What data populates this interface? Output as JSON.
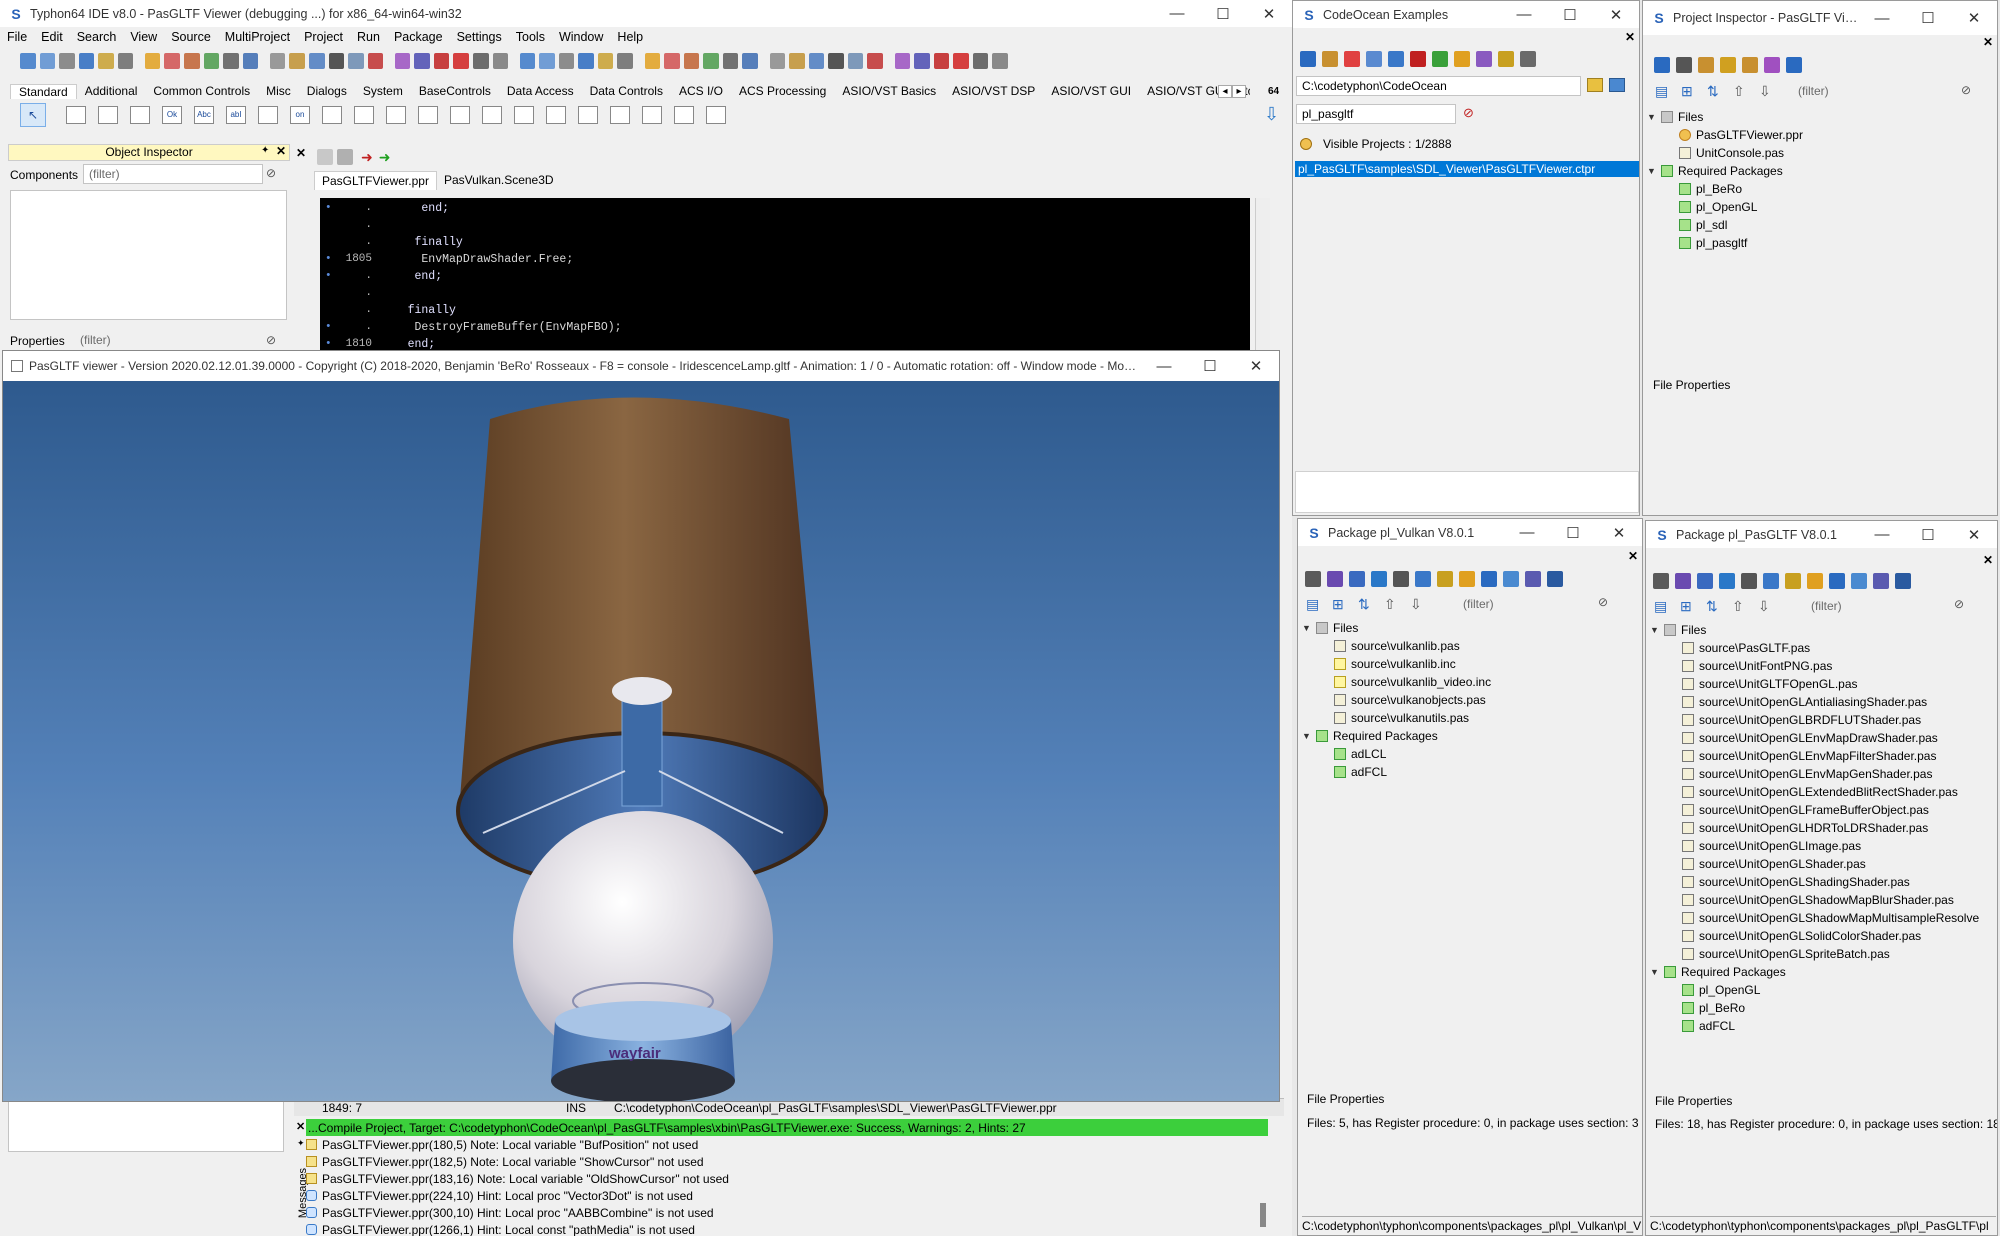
{
  "ide": {
    "title": "Typhon64 IDE v8.0 - PasGLTF Viewer (debugging ...) for x86_64-win64-win32",
    "menu": [
      "File",
      "Edit",
      "Search",
      "View",
      "Source",
      "MultiProject",
      "Project",
      "Run",
      "Package",
      "Settings",
      "Tools",
      "Window",
      "Help"
    ],
    "palette_tabs": [
      "Standard",
      "Additional",
      "Common Controls",
      "Misc",
      "Dialogs",
      "System",
      "BaseControls",
      "Data Access",
      "Data Controls",
      "ACS I/O",
      "ACS Processing",
      "ASIO/VST Basics",
      "ASIO/VST DSP",
      "ASIO/VST GUI",
      "ASIO/VST GUI Stitched",
      "ASIO/"
    ],
    "palette_icons": [
      "Ok",
      "Abc",
      "abI",
      "on"
    ],
    "palette_extra": "64"
  },
  "object_inspector": {
    "title": "Object Inspector",
    "components_label": "Components",
    "components_filter": "(filter)",
    "properties_label": "Properties",
    "properties_filter": "(filter)"
  },
  "editor": {
    "tabs": [
      "PasGLTFViewer.ppr",
      "PasVulkan.Scene3D"
    ],
    "lines": [
      {
        "gutter": "•",
        "num": ".",
        "code": "      end;"
      },
      {
        "gutter": "",
        "num": ".",
        "code": ""
      },
      {
        "gutter": "",
        "num": ".",
        "code": "     finally"
      },
      {
        "gutter": "•",
        "num": "1805",
        "code": "      EnvMapDrawShader.Free;"
      },
      {
        "gutter": "•",
        "num": ".",
        "code": "     end;"
      },
      {
        "gutter": "",
        "num": ".",
        "code": ""
      },
      {
        "gutter": "",
        "num": ".",
        "code": "    finally"
      },
      {
        "gutter": "•",
        "num": ".",
        "code": "     DestroyFrameBuffer(EnvMapFBO);"
      },
      {
        "gutter": "•",
        "num": "1810",
        "code": "    end;"
      }
    ],
    "status": {
      "pos": "1849: 7",
      "mode": "INS",
      "file": "C:\\codetyphon\\CodeOcean\\pl_PasGLTF\\samples\\SDL_Viewer\\PasGLTFViewer.ppr"
    }
  },
  "messages": {
    "label": "Messages",
    "compile": "...Compile Project, Target: C:\\codetyphon\\CodeOcean\\pl_PasGLTF\\samples\\xbin\\PasGLTFViewer.exe: Success, Warnings: 2, Hints: 27",
    "items": [
      "PasGLTFViewer.ppr(180,5) Note: Local variable \"BufPosition\" not used",
      "PasGLTFViewer.ppr(182,5) Note: Local variable \"ShowCursor\" not used",
      "PasGLTFViewer.ppr(183,16) Note: Local variable \"OldShowCursor\" not used",
      "PasGLTFViewer.ppr(224,10) Hint: Local proc \"Vector3Dot\" is not used",
      "PasGLTFViewer.ppr(300,10) Hint: Local proc \"AABBCombine\" is not used",
      "PasGLTFViewer.ppr(1266,1) Hint: Local const \"pathMedia\" is not used"
    ]
  },
  "viewer": {
    "title": "PasGLTF viewer - Version 2020.02.12.01.39.0000 - Copyright (C) 2018-2020, Benjamin 'BeRo' Rosseaux - F8 = console - IridescenceLamp.gltf - Animation: 1 / 0 - Automatic rotation:  off -  Window mode - Mouse ...",
    "base_label": "wayfair"
  },
  "codeocean": {
    "title": "CodeOcean Examples",
    "path": "C:\\codetyphon\\CodeOcean",
    "filter": "pl_pasgltf",
    "visible": "Visible Projects : 1/2888",
    "selected": "pl_PasGLTF\\samples\\SDL_Viewer\\PasGLTFViewer.ctpr"
  },
  "project_inspector": {
    "title": "Project Inspector - PasGLTF View...",
    "filter": "(filter)",
    "tree": [
      {
        "lvl": 0,
        "type": "fold",
        "text": "Files"
      },
      {
        "lvl": 1,
        "type": "ppr",
        "text": "PasGLTFViewer.ppr"
      },
      {
        "lvl": 1,
        "type": "file",
        "text": "UnitConsole.pas"
      },
      {
        "lvl": 0,
        "type": "pkg",
        "text": "Required Packages"
      },
      {
        "lvl": 1,
        "type": "pkg",
        "text": "pl_BeRo"
      },
      {
        "lvl": 1,
        "type": "pkg",
        "text": "pl_OpenGL"
      },
      {
        "lvl": 1,
        "type": "pkg",
        "text": "pl_sdl"
      },
      {
        "lvl": 1,
        "type": "pkg",
        "text": "pl_pasgltf"
      }
    ],
    "props_label": "File Properties"
  },
  "pkg_vulkan": {
    "title": "Package pl_Vulkan V8.0.1",
    "filter": "(filter)",
    "tree": [
      {
        "lvl": 0,
        "type": "fold",
        "text": "Files"
      },
      {
        "lvl": 1,
        "type": "file",
        "text": "source\\vulkanlib.pas"
      },
      {
        "lvl": 1,
        "type": "inc",
        "text": "source\\vulkanlib.inc"
      },
      {
        "lvl": 1,
        "type": "inc",
        "text": "source\\vulkanlib_video.inc"
      },
      {
        "lvl": 1,
        "type": "file",
        "text": "source\\vulkanobjects.pas"
      },
      {
        "lvl": 1,
        "type": "file",
        "text": "source\\vulkanutils.pas"
      },
      {
        "lvl": 0,
        "type": "pkg",
        "text": "Required Packages"
      },
      {
        "lvl": 1,
        "type": "pkg",
        "text": "adLCL"
      },
      {
        "lvl": 1,
        "type": "pkg",
        "text": "adFCL"
      }
    ],
    "props_label": "File Properties",
    "props_text": "Files: 5, has Register procedure: 0, in package uses section: 3",
    "path": "C:\\codetyphon\\typhon\\components\\packages_pl\\pl_Vulkan\\pl_V"
  },
  "pkg_pasgltf": {
    "title": "Package pl_PasGLTF V8.0.1",
    "filter": "(filter)",
    "tree": [
      {
        "lvl": 0,
        "type": "fold",
        "text": "Files"
      },
      {
        "lvl": 1,
        "type": "file",
        "text": "source\\PasGLTF.pas"
      },
      {
        "lvl": 1,
        "type": "file",
        "text": "source\\UnitFontPNG.pas"
      },
      {
        "lvl": 1,
        "type": "file",
        "text": "source\\UnitGLTFOpenGL.pas"
      },
      {
        "lvl": 1,
        "type": "file",
        "text": "source\\UnitOpenGLAntialiasingShader.pas"
      },
      {
        "lvl": 1,
        "type": "file",
        "text": "source\\UnitOpenGLBRDFLUTShader.pas"
      },
      {
        "lvl": 1,
        "type": "file",
        "text": "source\\UnitOpenGLEnvMapDrawShader.pas"
      },
      {
        "lvl": 1,
        "type": "file",
        "text": "source\\UnitOpenGLEnvMapFilterShader.pas"
      },
      {
        "lvl": 1,
        "type": "file",
        "text": "source\\UnitOpenGLEnvMapGenShader.pas"
      },
      {
        "lvl": 1,
        "type": "file",
        "text": "source\\UnitOpenGLExtendedBlitRectShader.pas"
      },
      {
        "lvl": 1,
        "type": "file",
        "text": "source\\UnitOpenGLFrameBufferObject.pas"
      },
      {
        "lvl": 1,
        "type": "file",
        "text": "source\\UnitOpenGLHDRToLDRShader.pas"
      },
      {
        "lvl": 1,
        "type": "file",
        "text": "source\\UnitOpenGLImage.pas"
      },
      {
        "lvl": 1,
        "type": "file",
        "text": "source\\UnitOpenGLShader.pas"
      },
      {
        "lvl": 1,
        "type": "file",
        "text": "source\\UnitOpenGLShadingShader.pas"
      },
      {
        "lvl": 1,
        "type": "file",
        "text": "source\\UnitOpenGLShadowMapBlurShader.pas"
      },
      {
        "lvl": 1,
        "type": "file",
        "text": "source\\UnitOpenGLShadowMapMultisampleResolve"
      },
      {
        "lvl": 1,
        "type": "file",
        "text": "source\\UnitOpenGLSolidColorShader.pas"
      },
      {
        "lvl": 1,
        "type": "file",
        "text": "source\\UnitOpenGLSpriteBatch.pas"
      },
      {
        "lvl": 0,
        "type": "pkg",
        "text": "Required Packages"
      },
      {
        "lvl": 1,
        "type": "pkg",
        "text": "pl_OpenGL"
      },
      {
        "lvl": 1,
        "type": "pkg",
        "text": "pl_BeRo"
      },
      {
        "lvl": 1,
        "type": "pkg",
        "text": "adFCL"
      }
    ],
    "props_label": "File Properties",
    "props_text": "Files: 18, has Register procedure: 0, in package uses section: 18",
    "path": "C:\\codetyphon\\typhon\\components\\packages_pl\\pl_PasGLTF\\pl"
  },
  "window_controls": {
    "min": "—",
    "max": "☐",
    "close": "✕"
  },
  "colors": {
    "accent": "#0078d7",
    "compile_ok": "#3ccf3c",
    "selection": "#0078d7",
    "lampshade": "#7a5a3a",
    "sky": "#4a7ab0"
  }
}
